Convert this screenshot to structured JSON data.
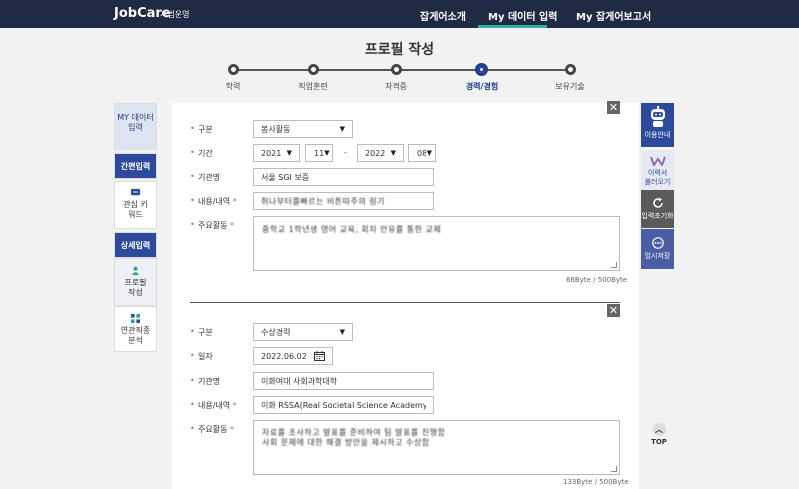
{
  "header": {
    "logo": "JobCare",
    "logo_sub": "시범운영",
    "nav": [
      "잡게어소개",
      "My 데이터 입력",
      "My 잡게어보고서"
    ]
  },
  "page_title": "프로필 작성",
  "steps": [
    "학력",
    "직업훈련",
    "자격증",
    "경력/경험",
    "보유기술"
  ],
  "left_sidebar": {
    "my_label": "MY 데이터 입력",
    "simple_header": "간편입력",
    "interest": "관심 키워드",
    "detail_header": "상세입력",
    "profile": "프로필 작성",
    "related": "연관직종 분석"
  },
  "section1": {
    "label_type": "구분",
    "type_value": "봉사활동",
    "label_period": "기간",
    "start_year": "2021",
    "start_month": "11",
    "end_year": "2022",
    "end_month": "08",
    "label_org": "기관명",
    "org_value": "서울 SGI 보증",
    "label_content": "내용/내역",
    "content_value": "취나부터를빠르는 비튼따주의 링기",
    "label_main": "주요활동",
    "main_value": "중학교 1학년생 영어 교육, 회차 안유를 통한 교체",
    "counter": "66Byte / 500Byte"
  },
  "section2": {
    "label_type": "구분",
    "type_value": "수상경력",
    "label_date": "일자",
    "date_value": "2022.06.02",
    "label_org": "기관명",
    "org_value": "이화여대 사회과학대학",
    "label_content": "내용/내역",
    "content_value": "이화 RSSA(Real Societal Science Academy)",
    "label_main": "주요활동",
    "main_line1": "자료를 조사하고 발표를 준비하여 팀 발표를 진행함",
    "main_line2": "사회 문제에 대한 해결 방안을 제시하고 수상함",
    "counter": "133Byte / 500Byte"
  },
  "right_sidebar": {
    "guide": "이용안내",
    "resume": "이력서 불러오기",
    "reset": "입력초기화",
    "save": "임시저장",
    "top": "TOP"
  },
  "colors": {
    "header_bg": "#1f2a44",
    "accent_teal": "#2bb3a0",
    "primary_blue": "#2e4a9c",
    "required_orange": "#c96a2e"
  }
}
